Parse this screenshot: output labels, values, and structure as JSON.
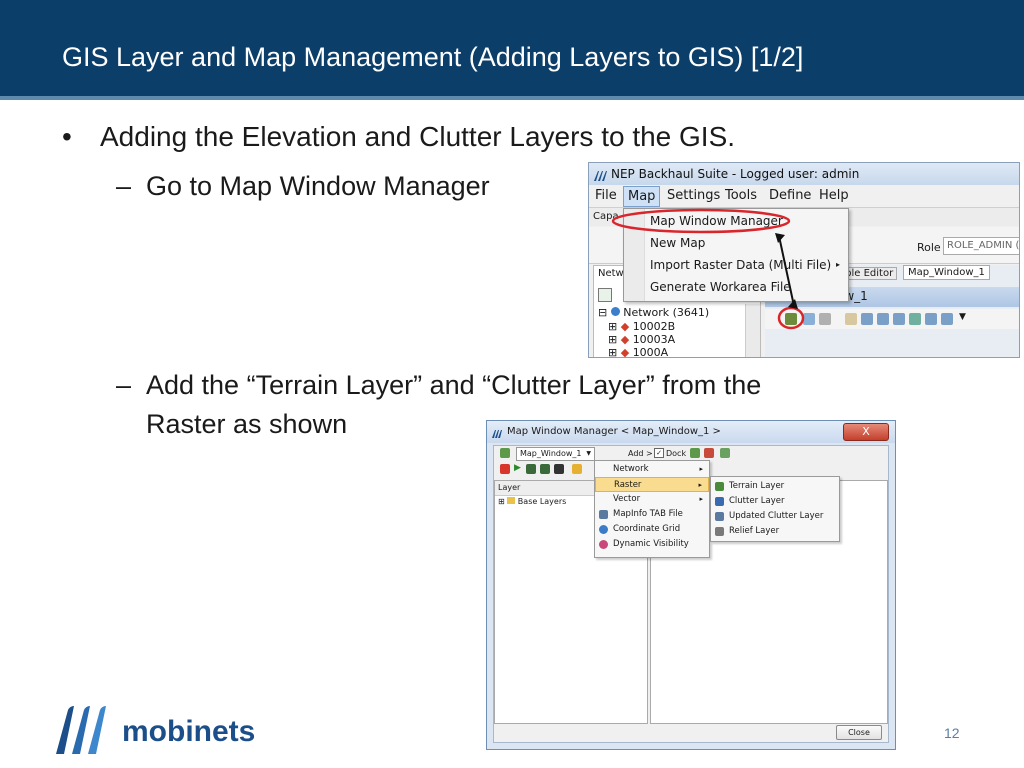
{
  "slide": {
    "title": "GIS Layer and Map Management (Adding Layers to GIS)    [1/2]",
    "bullet1": "Adding the Elevation and Clutter Layers to the GIS.",
    "dash1": "Go to Map Window Manager",
    "dash2_line1": "Add the “Terrain Layer” and “Clutter Layer” from the",
    "dash2_line2": "Raster as shown",
    "page_number": "12",
    "logo_text": "mobinets",
    "bullet_char": "•",
    "dash_char": "–"
  },
  "shot1": {
    "window_title": "NEP Backhaul Suite - Logged user: admin",
    "menu": [
      "File",
      "Map",
      "Settings",
      "Tools",
      "Define",
      "Help"
    ],
    "dropdown": [
      "Map Window Manager",
      "New Map",
      "Import Raster Data (Multi File)",
      "Generate Workarea File"
    ],
    "partial_tab": "Capa",
    "role_label": "Role",
    "role_value": "ROLE_ADMIN (",
    "left_tab": "Netw",
    "tab_table_editor": "able Editor",
    "tab_map_window": "Map_Window_1",
    "map_caption": "ow_1",
    "tree": [
      "Network (3641)",
      "10002B",
      "10003A",
      "1000A"
    ]
  },
  "shot2": {
    "title": "Map Window Manager    < Map_Window_1 >",
    "close_x": "X",
    "map_select": "Map_Window_1",
    "add_label": "Add >",
    "dock_label": "Dock",
    "layer_header": "Layer",
    "base_layers": "Base Layers",
    "add_menu": [
      "Network",
      "Raster",
      "Vector",
      "MapInfo TAB File",
      "Coordinate Grid",
      "Dynamic Visibility"
    ],
    "raster_menu": [
      "Terrain Layer",
      "Clutter Layer",
      "Updated Clutter Layer",
      "Relief Layer"
    ],
    "close_button": "Close"
  },
  "colors": {
    "header_bg": "#0c3e6a",
    "highlight_red": "#d9262c",
    "menu_highlight": "#f7d98a",
    "logo_blue": "#1c4f8a"
  }
}
